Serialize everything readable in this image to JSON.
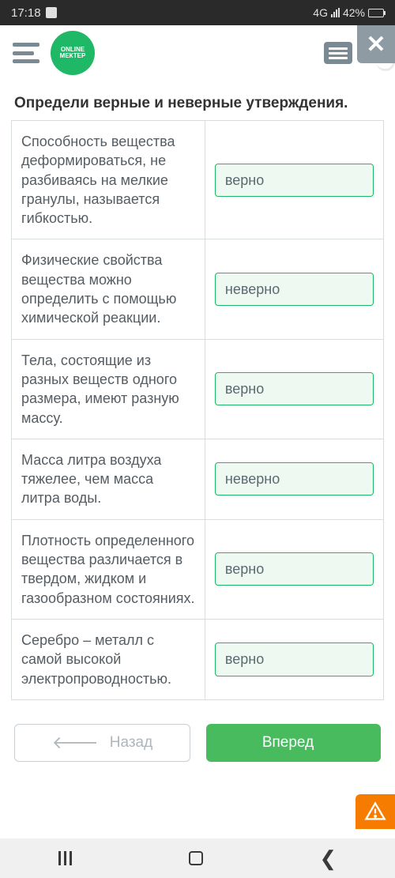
{
  "status": {
    "time": "17:18",
    "net": "4G",
    "battery": "42%"
  },
  "logo": {
    "line1": "ONLINE",
    "line2": "МЕКТЕР"
  },
  "close": "✕",
  "question": "Определи верные и неверные утверждения.",
  "rows": [
    {
      "statement": "Способность вещества деформироваться, не разбиваясь на мелкие гранулы, называется гибкостью.",
      "answer": "верно"
    },
    {
      "statement": "Физические свойства вещества можно определить с помощью химической реакции.",
      "answer": "неверно"
    },
    {
      "statement": "Тела, состоящие из разных веществ одного размера, имеют разную массу.",
      "answer": "верно"
    },
    {
      "statement": "Масса литра воздуха тяжелее, чем масса литра воды.",
      "answer": "неверно"
    },
    {
      "statement": "Плотность определенного вещества различается в твердом, жидком и газообразном состояниях.",
      "answer": "верно"
    },
    {
      "statement": "Серебро – металл с самой высокой электропроводностью.",
      "answer": "верно"
    }
  ],
  "nav": {
    "back": "Назад",
    "forward": "Вперед"
  }
}
